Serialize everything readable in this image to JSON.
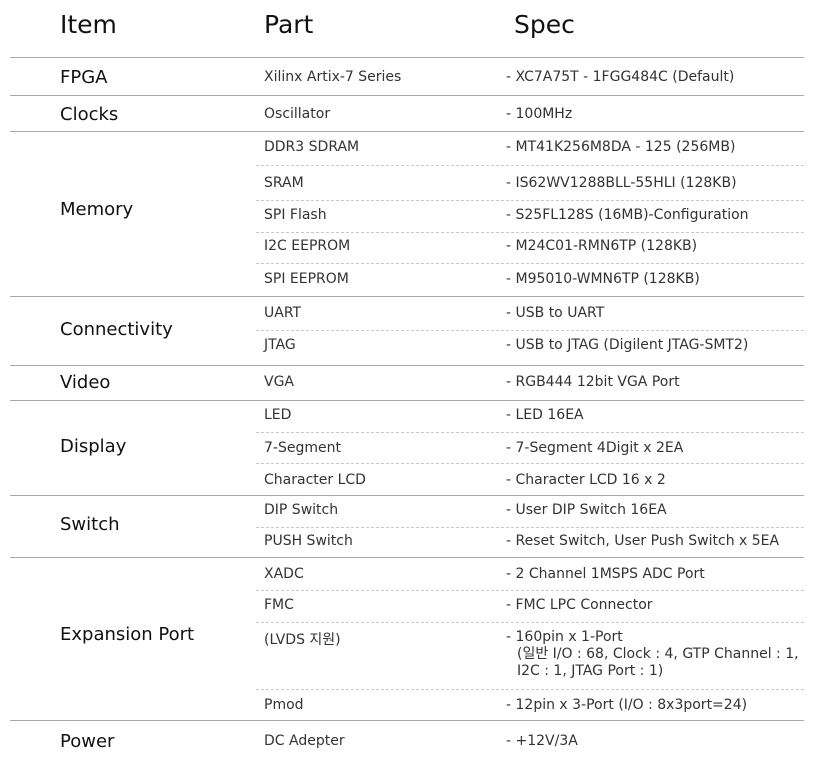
{
  "headers": {
    "item": "Item",
    "part": "Part",
    "spec": "Spec"
  },
  "groups": [
    {
      "item": "FPGA",
      "rows": [
        {
          "part": "Xilinx Artix-7 Series",
          "spec": [
            "- XC7A75T - 1FGG484C (Default)"
          ]
        }
      ]
    },
    {
      "item": "Clocks",
      "rows": [
        {
          "part": "Oscillator",
          "spec": [
            "- 100MHz"
          ]
        }
      ]
    },
    {
      "item": "Memory",
      "rows": [
        {
          "part": "DDR3 SDRAM",
          "spec": [
            "- MT41K256M8DA - 125 (256MB)"
          ]
        },
        {
          "part": "SRAM",
          "spec": [
            "- IS62WV1288BLL-55HLI (128KB)"
          ]
        },
        {
          "part": "SPI Flash",
          "spec": [
            "- S25FL128S (16MB)-Configuration"
          ]
        },
        {
          "part": "I2C EEPROM",
          "spec": [
            "- M24C01-RMN6TP (128KB)"
          ]
        },
        {
          "part": "SPI EEPROM",
          "spec": [
            "- M95010-WMN6TP (128KB)"
          ]
        }
      ]
    },
    {
      "item": "Connectivity",
      "rows": [
        {
          "part": "UART",
          "spec": [
            "- USB to UART"
          ]
        },
        {
          "part": "JTAG",
          "spec": [
            "- USB to JTAG (Digilent JTAG-SMT2)"
          ]
        }
      ]
    },
    {
      "item": "Video",
      "rows": [
        {
          "part": "VGA",
          "spec": [
            "- RGB444 12bit VGA Port"
          ]
        }
      ]
    },
    {
      "item": "Display",
      "rows": [
        {
          "part": "LED",
          "spec": [
            "- LED 16EA"
          ]
        },
        {
          "part": "7-Segment",
          "spec": [
            "- 7-Segment 4Digit x 2EA"
          ]
        },
        {
          "part": "Character LCD",
          "spec": [
            "- Character LCD 16 x 2"
          ]
        }
      ]
    },
    {
      "item": "Switch",
      "rows": [
        {
          "part": "DIP Switch",
          "spec": [
            "- User DIP Switch 16EA"
          ]
        },
        {
          "part": "PUSH Switch",
          "spec": [
            "- Reset Switch, User Push Switch x 5EA"
          ]
        }
      ]
    },
    {
      "item": "Expansion Port",
      "rows": [
        {
          "part": "XADC",
          "spec": [
            "- 2 Channel 1MSPS ADC Port"
          ]
        },
        {
          "part": "FMC",
          "spec": [
            "- FMC LPC Connector"
          ]
        },
        {
          "part": "(LVDS 지원)",
          "spec": [
            "- 160pin x 1-Port",
            "(일반 I/O : 68, Clock : 4, GTP Channel : 1,",
            "I2C : 1, JTAG Port : 1)"
          ]
        },
        {
          "part": "Pmod",
          "spec": [
            "- 12pin x 3-Port (I/O : 8x3port=24)"
          ]
        }
      ]
    },
    {
      "item": "Power",
      "rows": [
        {
          "part": "DC Adepter",
          "spec": [
            "- +12V/3A"
          ]
        }
      ]
    }
  ]
}
